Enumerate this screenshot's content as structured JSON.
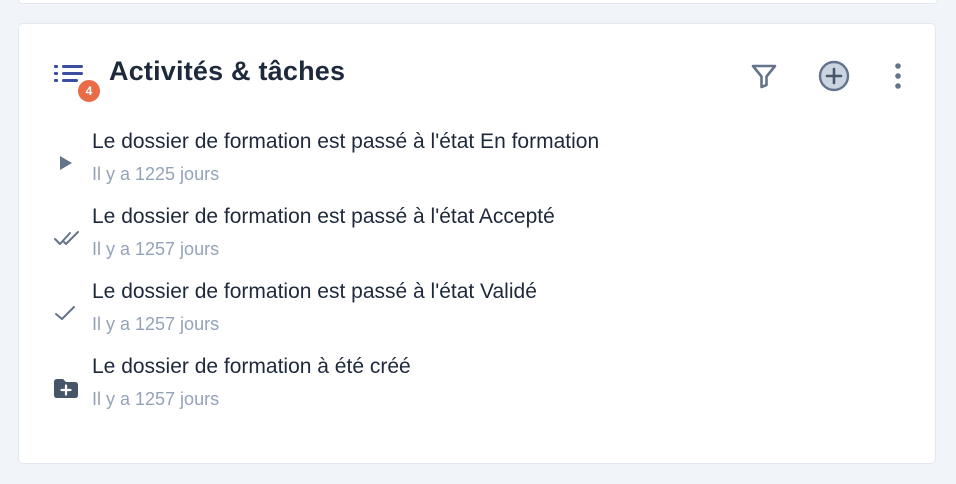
{
  "panel": {
    "title": "Activités & tâches",
    "badge_count": "4",
    "icons": {
      "list": "list-icon",
      "filter": "filter-icon",
      "add": "add-circle-icon",
      "more": "more-vertical-icon"
    },
    "colors": {
      "badge": "#ea6c47",
      "title": "#1e293b",
      "text": "#1e293b",
      "muted": "#94a3b8",
      "icon": "#64748b",
      "list_icon": "#3b4fa0"
    }
  },
  "activities": [
    {
      "icon": "play-icon",
      "text": "Le dossier de formation est passé à l'état En formation",
      "time": "Il y a 1225 jours"
    },
    {
      "icon": "double-check-icon",
      "text": "Le dossier de formation est passé à l'état Accepté",
      "time": "Il y a 1257 jours"
    },
    {
      "icon": "check-icon",
      "text": "Le dossier de formation est passé à l'état Validé",
      "time": "Il y a 1257 jours"
    },
    {
      "icon": "folder-add-icon",
      "text": "Le dossier de formation à été créé",
      "time": "Il y a 1257 jours"
    }
  ]
}
